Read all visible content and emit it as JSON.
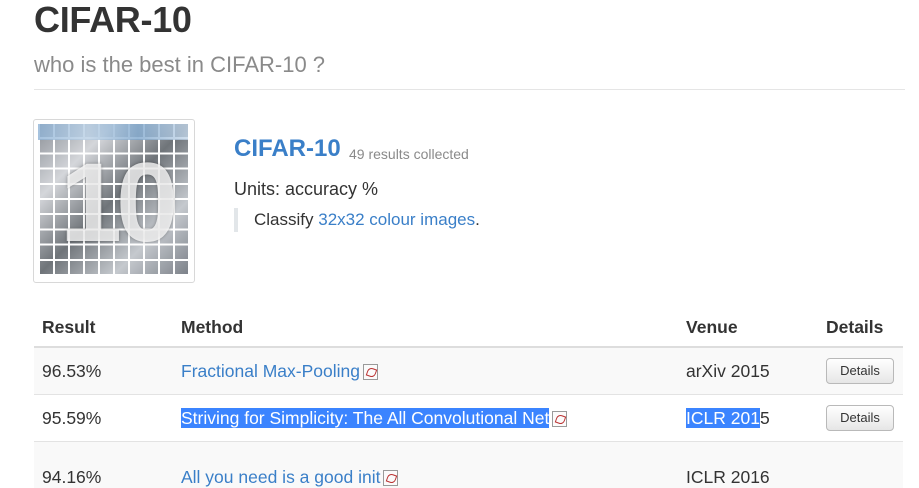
{
  "header": {
    "title": "CIFAR-10",
    "subtitle": "who is the best in CIFAR-10 ?"
  },
  "dataset": {
    "title": "CIFAR-10",
    "result_count": "49 results collected",
    "units": "Units: accuracy %",
    "description_prefix": "Classify ",
    "description_link": "32x32 colour images",
    "description_suffix": ".",
    "thumbnail_digits": "10"
  },
  "table": {
    "headers": {
      "result": "Result",
      "method": "Method",
      "venue": "Venue",
      "details": "Details"
    },
    "rows": [
      {
        "result": "96.53%",
        "method": "Fractional Max-Pooling",
        "venue": "arXiv 2015",
        "details": "Details"
      },
      {
        "result": "95.59%",
        "method": "Striving for Simplicity: The All Convolutional Net",
        "venue_selected": "ICLR 201",
        "venue_rest": "5",
        "details": "Details"
      },
      {
        "result": "94.16%",
        "method": "All you need is a good init",
        "venue": "ICLR 2016"
      }
    ]
  },
  "colors": {
    "link": "#3a7fc8",
    "selection": "#3b84ff",
    "subtitle": "#8a8a8a"
  },
  "icons": {
    "pdf": "pdf-icon"
  }
}
